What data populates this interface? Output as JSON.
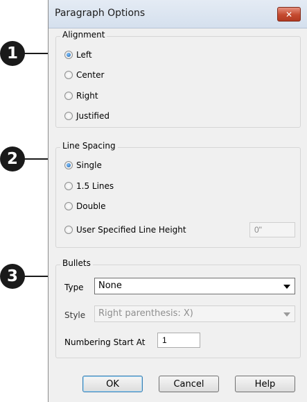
{
  "callouts": [
    "1",
    "2",
    "3"
  ],
  "dialog": {
    "title": "Paragraph Options",
    "close_glyph": "✕"
  },
  "alignment": {
    "legend": "Alignment",
    "options": [
      "Left",
      "Center",
      "Right",
      "Justified"
    ],
    "selected": "Left"
  },
  "line_spacing": {
    "legend": "Line Spacing",
    "options": [
      "Single",
      "1.5 Lines",
      "Double",
      "User Specified Line Height"
    ],
    "selected": "Single",
    "line_height_value": "0\""
  },
  "bullets": {
    "legend": "Bullets",
    "type_label": "Type",
    "type_value": "None",
    "style_label": "Style",
    "style_value": "Right parenthesis: X)",
    "numbering_label": "Numbering Start At",
    "numbering_value": "1"
  },
  "buttons": {
    "ok": "OK",
    "cancel": "Cancel",
    "help": "Help"
  },
  "colors": {
    "callout": "#1a1a1a",
    "close_button": "#c44a2f",
    "dialog_bg": "#f0f0f0"
  }
}
